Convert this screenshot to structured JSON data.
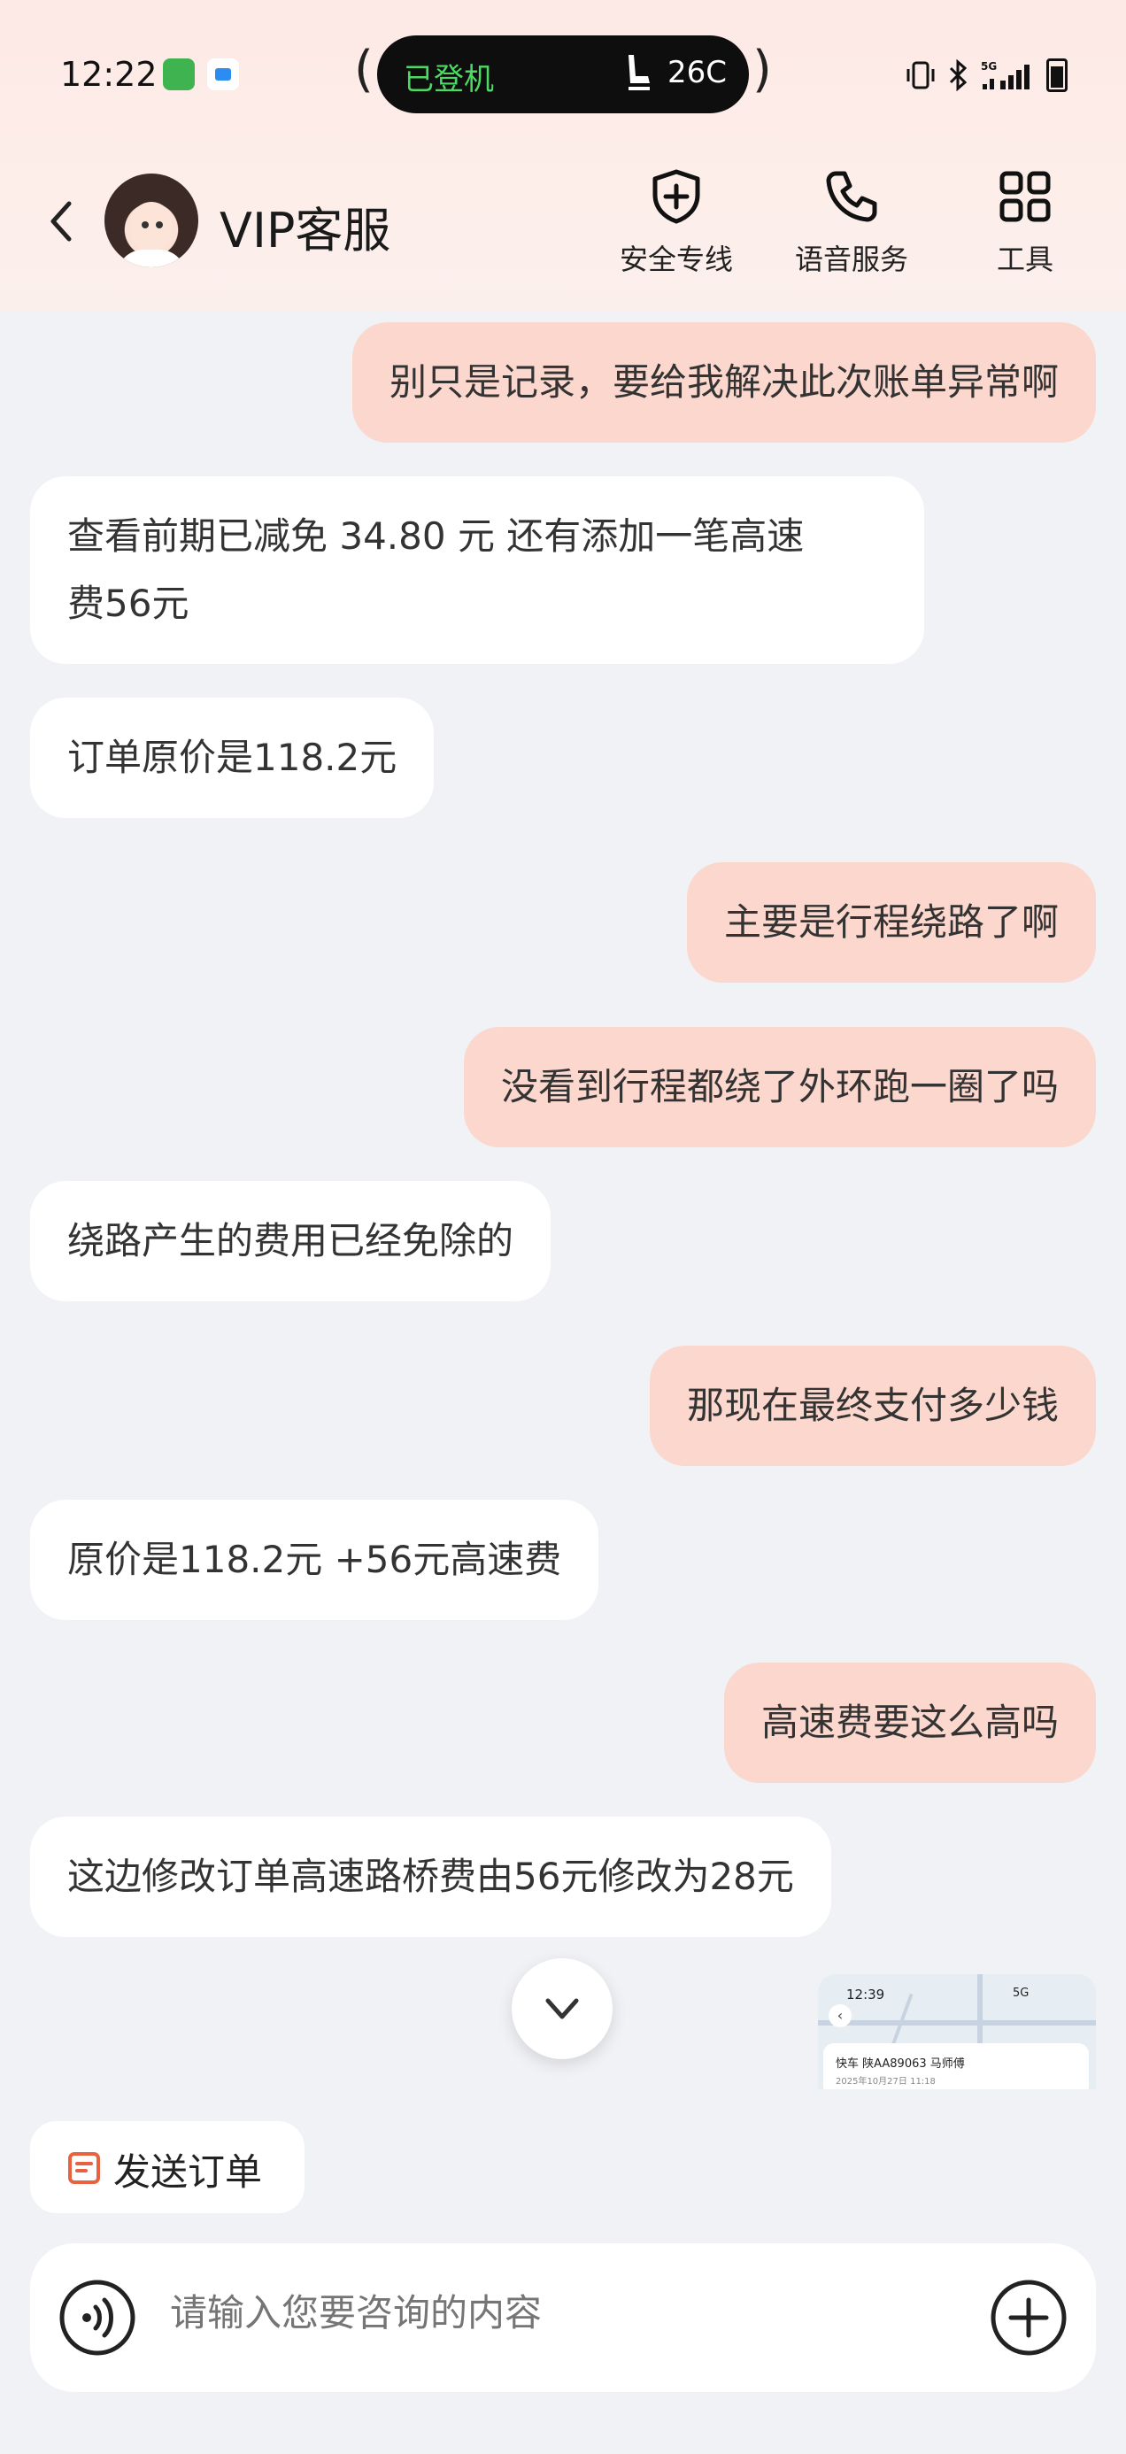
{
  "status_bar": {
    "time": "12:22",
    "island_left": "已登机",
    "island_right": "26C",
    "network": "5G"
  },
  "nav": {
    "title": "VIP客服",
    "actions": [
      {
        "label": "安全专线",
        "icon": "shield-plus-icon"
      },
      {
        "label": "语音服务",
        "icon": "phone-icon"
      },
      {
        "label": "工具",
        "icon": "grid-icon"
      }
    ]
  },
  "messages": [
    {
      "role": "user",
      "text": "别只是记录，要给我解决此次账单异常啊"
    },
    {
      "role": "agent",
      "lines": [
        "查看前期已减免 34.80 元 还有添加一笔高速",
        "费56元"
      ]
    },
    {
      "role": "agent",
      "text": "订单原价是118.2元"
    },
    {
      "role": "user",
      "text": "主要是行程绕路了啊"
    },
    {
      "role": "user",
      "text": "没看到行程都绕了外环跑一圈了吗"
    },
    {
      "role": "agent",
      "text": "绕路产生的费用已经免除的"
    },
    {
      "role": "user",
      "text": "那现在最终支付多少钱"
    },
    {
      "role": "agent",
      "text": "原价是118.2元 +56元高速费"
    },
    {
      "role": "user",
      "text": "高速费要这么高吗"
    },
    {
      "role": "agent",
      "text": "这边修改订单高速路桥费由56元修改为28元"
    }
  ],
  "thumbnail": {
    "time": "12:39",
    "status": "5G",
    "line1": "快车  陕AA89063  马师傅",
    "line2": "2025年10月27日 11:18"
  },
  "send_order": {
    "label": "发送订单"
  },
  "input": {
    "placeholder": "请输入您要咨询的内容"
  },
  "colors": {
    "user_bubble": "#fbd7cd",
    "agent_bubble": "#ffffff",
    "background": "#f1f2f6",
    "header": "#fde9e5",
    "accent": "#e8623f"
  }
}
